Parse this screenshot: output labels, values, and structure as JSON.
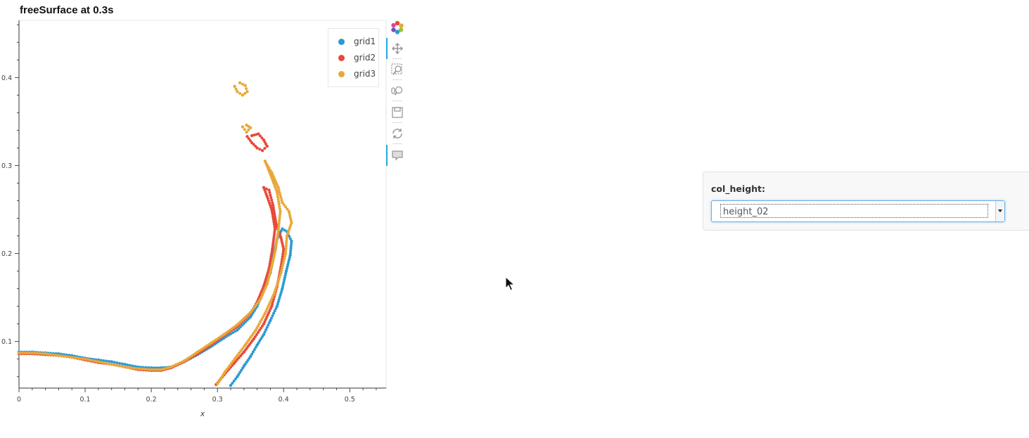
{
  "chart_data": {
    "type": "scatter",
    "title": "freeSurface at 0.3s",
    "xlabel": "x",
    "ylabel": "",
    "xlim": [
      0,
      0.555
    ],
    "ylim": [
      0.047,
      0.465
    ],
    "x_ticks": [
      0,
      0.1,
      0.2,
      0.3,
      0.4,
      0.5
    ],
    "x_tick_labels": [
      "0",
      "0.1",
      "0.2",
      "0.3",
      "0.4",
      "0.5"
    ],
    "y_ticks": [
      0.1,
      0.2,
      0.3,
      0.4
    ],
    "y_tick_labels": [
      "0.1",
      "0.2",
      "0.3",
      "0.4"
    ],
    "legend_position": "top-right",
    "series": [
      {
        "name": "grid1",
        "color": "#2b9ad3",
        "points": [
          [
            0.0,
            0.088
          ],
          [
            0.02,
            0.088
          ],
          [
            0.04,
            0.087
          ],
          [
            0.06,
            0.086
          ],
          [
            0.08,
            0.084
          ],
          [
            0.1,
            0.081
          ],
          [
            0.12,
            0.079
          ],
          [
            0.14,
            0.077
          ],
          [
            0.16,
            0.074
          ],
          [
            0.18,
            0.071
          ],
          [
            0.2,
            0.07
          ],
          [
            0.215,
            0.07
          ],
          [
            0.23,
            0.071
          ],
          [
            0.25,
            0.077
          ],
          [
            0.27,
            0.085
          ],
          [
            0.29,
            0.094
          ],
          [
            0.31,
            0.104
          ],
          [
            0.33,
            0.113
          ],
          [
            0.35,
            0.128
          ],
          [
            0.36,
            0.14
          ],
          [
            0.37,
            0.158
          ],
          [
            0.38,
            0.178
          ],
          [
            0.385,
            0.198
          ],
          [
            0.39,
            0.216
          ],
          [
            0.398,
            0.228
          ],
          [
            0.405,
            0.225
          ],
          [
            0.412,
            0.214
          ],
          [
            0.41,
            0.198
          ],
          [
            0.404,
            0.18
          ],
          [
            0.398,
            0.16
          ],
          [
            0.39,
            0.14
          ],
          [
            0.38,
            0.124
          ],
          [
            0.37,
            0.108
          ],
          [
            0.36,
            0.096
          ],
          [
            0.35,
            0.083
          ],
          [
            0.34,
            0.072
          ],
          [
            0.33,
            0.06
          ],
          [
            0.32,
            0.05
          ]
        ]
      },
      {
        "name": "grid2",
        "color": "#e8493a",
        "points": [
          [
            0.0,
            0.086
          ],
          [
            0.02,
            0.086
          ],
          [
            0.04,
            0.085
          ],
          [
            0.06,
            0.084
          ],
          [
            0.08,
            0.082
          ],
          [
            0.1,
            0.079
          ],
          [
            0.12,
            0.076
          ],
          [
            0.14,
            0.074
          ],
          [
            0.16,
            0.071
          ],
          [
            0.18,
            0.068
          ],
          [
            0.2,
            0.067
          ],
          [
            0.215,
            0.067
          ],
          [
            0.23,
            0.07
          ],
          [
            0.25,
            0.077
          ],
          [
            0.27,
            0.086
          ],
          [
            0.29,
            0.096
          ],
          [
            0.31,
            0.107
          ],
          [
            0.33,
            0.117
          ],
          [
            0.35,
            0.132
          ],
          [
            0.36,
            0.145
          ],
          [
            0.37,
            0.163
          ],
          [
            0.378,
            0.183
          ],
          [
            0.383,
            0.205
          ],
          [
            0.387,
            0.228
          ],
          [
            0.382,
            0.25
          ],
          [
            0.375,
            0.265
          ],
          [
            0.37,
            0.275
          ],
          [
            0.378,
            0.272
          ],
          [
            0.384,
            0.255
          ],
          [
            0.389,
            0.233
          ],
          [
            0.396,
            0.218
          ],
          [
            0.4,
            0.205
          ],
          [
            0.396,
            0.185
          ],
          [
            0.39,
            0.162
          ],
          [
            0.382,
            0.14
          ],
          [
            0.37,
            0.12
          ],
          [
            0.355,
            0.103
          ],
          [
            0.34,
            0.088
          ],
          [
            0.325,
            0.075
          ],
          [
            0.31,
            0.062
          ],
          [
            0.298,
            0.051
          ],
          [
            0.345,
            0.333
          ],
          [
            0.352,
            0.326
          ],
          [
            0.36,
            0.32
          ],
          [
            0.368,
            0.317
          ],
          [
            0.375,
            0.322
          ],
          [
            0.37,
            0.329
          ],
          [
            0.362,
            0.336
          ],
          [
            0.352,
            0.334
          ]
        ]
      },
      {
        "name": "grid3",
        "color": "#e8a838",
        "points": [
          [
            0.0,
            0.087
          ],
          [
            0.02,
            0.087
          ],
          [
            0.04,
            0.086
          ],
          [
            0.06,
            0.084
          ],
          [
            0.08,
            0.082
          ],
          [
            0.1,
            0.08
          ],
          [
            0.12,
            0.077
          ],
          [
            0.14,
            0.074
          ],
          [
            0.16,
            0.071
          ],
          [
            0.18,
            0.069
          ],
          [
            0.2,
            0.068
          ],
          [
            0.215,
            0.068
          ],
          [
            0.23,
            0.071
          ],
          [
            0.25,
            0.078
          ],
          [
            0.27,
            0.088
          ],
          [
            0.29,
            0.098
          ],
          [
            0.31,
            0.108
          ],
          [
            0.33,
            0.119
          ],
          [
            0.35,
            0.133
          ],
          [
            0.365,
            0.148
          ],
          [
            0.375,
            0.165
          ],
          [
            0.382,
            0.185
          ],
          [
            0.388,
            0.205
          ],
          [
            0.392,
            0.226
          ],
          [
            0.395,
            0.248
          ],
          [
            0.39,
            0.27
          ],
          [
            0.38,
            0.29
          ],
          [
            0.372,
            0.305
          ],
          [
            0.382,
            0.292
          ],
          [
            0.392,
            0.275
          ],
          [
            0.398,
            0.258
          ],
          [
            0.408,
            0.248
          ],
          [
            0.412,
            0.235
          ],
          [
            0.405,
            0.22
          ],
          [
            0.403,
            0.2
          ],
          [
            0.396,
            0.178
          ],
          [
            0.386,
            0.155
          ],
          [
            0.372,
            0.132
          ],
          [
            0.358,
            0.113
          ],
          [
            0.342,
            0.096
          ],
          [
            0.326,
            0.08
          ],
          [
            0.312,
            0.066
          ],
          [
            0.3,
            0.052
          ],
          [
            0.338,
            0.344
          ],
          [
            0.344,
            0.338
          ],
          [
            0.35,
            0.343
          ],
          [
            0.344,
            0.346
          ],
          [
            0.326,
            0.39
          ],
          [
            0.33,
            0.384
          ],
          [
            0.338,
            0.38
          ],
          [
            0.345,
            0.384
          ],
          [
            0.342,
            0.391
          ],
          [
            0.334,
            0.394
          ]
        ]
      }
    ]
  },
  "toolbar": {
    "icons": [
      "bokeh-logo-icon",
      "pan-icon",
      "box-zoom-icon",
      "wheel-zoom-icon",
      "save-icon",
      "reset-icon",
      "hover-icon"
    ]
  },
  "widget": {
    "label": "col_height:",
    "selected": "height_02"
  }
}
